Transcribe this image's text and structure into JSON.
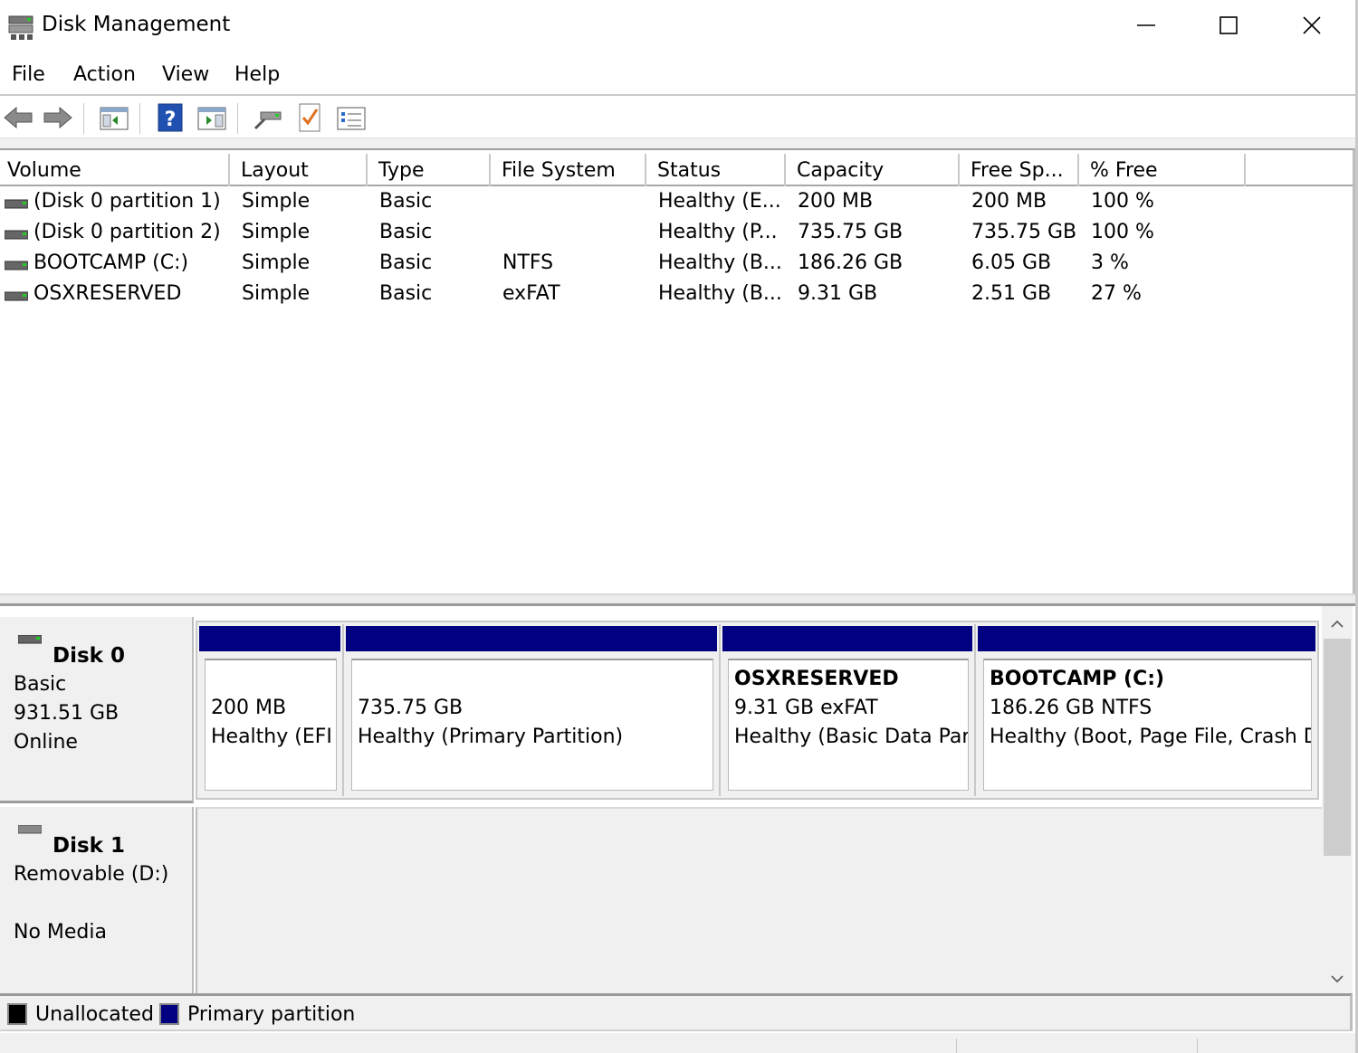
{
  "window": {
    "title": "Disk Management",
    "icon": "disk-management-icon"
  },
  "menu": {
    "file": "File",
    "action": "Action",
    "view": "View",
    "help": "Help"
  },
  "toolbar": {
    "buttons": [
      "back-arrow-icon",
      "forward-arrow-icon",
      "show-hide-console-tree-icon",
      "help-icon",
      "properties-pane-icon",
      "connect-disk-icon",
      "check-icon",
      "settings-list-icon"
    ]
  },
  "volume_list": {
    "columns": [
      "Volume",
      "Layout",
      "Type",
      "File System",
      "Status",
      "Capacity",
      "Free Sp...",
      "% Free"
    ],
    "rows": [
      {
        "volume": "(Disk 0 partition 1)",
        "layout": "Simple",
        "type": "Basic",
        "fs": "",
        "status": "Healthy (E...",
        "capacity": "200 MB",
        "free": "200 MB",
        "pct": "100 %"
      },
      {
        "volume": "(Disk 0 partition 2)",
        "layout": "Simple",
        "type": "Basic",
        "fs": "",
        "status": "Healthy (P...",
        "capacity": "735.75 GB",
        "free": "735.75 GB",
        "pct": "100 %"
      },
      {
        "volume": "BOOTCAMP (C:)",
        "layout": "Simple",
        "type": "Basic",
        "fs": "NTFS",
        "status": "Healthy (B...",
        "capacity": "186.26 GB",
        "free": "6.05 GB",
        "pct": "3 %"
      },
      {
        "volume": "OSXRESERVED",
        "layout": "Simple",
        "type": "Basic",
        "fs": "exFAT",
        "status": "Healthy (B...",
        "capacity": "9.31 GB",
        "free": "2.51 GB",
        "pct": "27 %"
      }
    ]
  },
  "disks": {
    "disk0": {
      "name": "Disk 0",
      "type": "Basic",
      "size": "931.51 GB",
      "state": "Online",
      "partitions": [
        {
          "title": "",
          "line1": "200 MB",
          "line2": "Healthy (EFI"
        },
        {
          "title": "",
          "line1": "735.75 GB",
          "line2": "Healthy (Primary Partition)"
        },
        {
          "title": "OSXRESERVED",
          "line1": "9.31 GB exFAT",
          "line2": "Healthy (Basic Data Part"
        },
        {
          "title": "BOOTCAMP  (C:)",
          "line1": "186.26 GB NTFS",
          "line2": "Healthy (Boot, Page File, Crash D"
        }
      ]
    },
    "disk1": {
      "name": "Disk 1",
      "type": "Removable (D:)",
      "media": "No Media"
    }
  },
  "legend": {
    "unallocated": "Unallocated",
    "primary": "Primary partition",
    "unallocated_color": "#000000",
    "primary_color": "#000080"
  }
}
